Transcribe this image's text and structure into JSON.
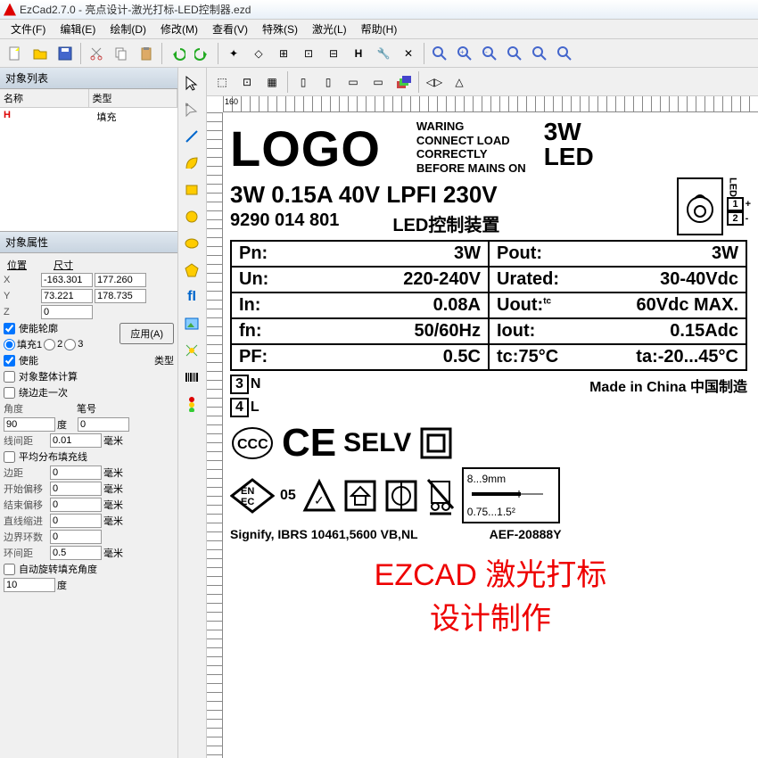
{
  "titlebar": {
    "text": "EzCad2.7.0 - 亮点设计-激光打标-LED控制器.ezd"
  },
  "menu": [
    "文件(F)",
    "编辑(E)",
    "绘制(D)",
    "修改(M)",
    "查看(V)",
    "特殊(S)",
    "激光(L)",
    "帮助(H)"
  ],
  "panels": {
    "objlist_title": "对象列表",
    "objprops_title": "对象属性",
    "col_name": "名称",
    "col_type": "类型",
    "row_type": "填充"
  },
  "props": {
    "pos_label": "位置",
    "size_label": "尺寸",
    "x": "-163.301",
    "w": "177.260",
    "y": "73.221",
    "h": "178.735",
    "z": "0",
    "apply": "应用(A)",
    "enable_outline": "使能轮廓",
    "fill1": "填充1",
    "fill2": "2",
    "fill3": "3",
    "enable": "使能",
    "type_label": "类型",
    "whole_calc": "对象整体计算",
    "edge_once": "绕边走一次",
    "angle_label": "角度",
    "pen_label": "笔号",
    "angle": "90",
    "angle_unit": "度",
    "pen": "0",
    "line_gap_label": "线间距",
    "line_gap": "0.01",
    "mm": "毫米",
    "avg_hatch": "平均分布填充线",
    "margin_label": "边距",
    "margin": "0",
    "start_off_label": "开始偏移",
    "start_off": "0",
    "end_off_label": "结束偏移",
    "end_off": "0",
    "line_red_label": "直线缩进",
    "line_red": "0",
    "loops_label": "边界环数",
    "loops": "0",
    "ring_gap_label": "环间距",
    "ring_gap": "0.5",
    "auto_rotate": "自动旋转填充角度",
    "auto_angle": "10"
  },
  "design": {
    "logo": "LOGO",
    "warn1": "WARING",
    "warn2": "CONNECT LOAD",
    "warn3": "CORRECTLY",
    "warn4": "BEFORE MAINS ON",
    "wattage": "3W",
    "led": "LED",
    "specline": "3W  0.15A 40V LPFI 230V",
    "partno": "9290 014 801",
    "devname": "LED控制装置",
    "term1": "1",
    "term1s": "+",
    "term2": "2",
    "term2s": "-",
    "specs": [
      {
        "l": "Pn:",
        "lv": "3W",
        "r": "Pout:",
        "rv": "3W"
      },
      {
        "l": "Un:",
        "lv": "220-240V",
        "r": "Urated:",
        "rv": "30-40Vdc"
      },
      {
        "l": "In:",
        "lv": "0.08A",
        "r": "Uout:",
        "rv": "60Vdc MAX."
      },
      {
        "l": "fn:",
        "lv": "50/60Hz",
        "r": "Iout:",
        "rv": "0.15Adc"
      },
      {
        "l": "PF:",
        "lv": "0.5C",
        "r": "tc:75°C",
        "rv": "ta:-20...45°C"
      }
    ],
    "term_n": "3",
    "term_n_lbl": "N",
    "term_l": "4",
    "term_l_lbl": "L",
    "made_in": "Made in China  中国制造",
    "selv": "SELV",
    "enec": "05",
    "dim1": "8...9mm",
    "dim2": "0.75...1.5²",
    "signify": "Signify, IBRS 10461,5600 VB,NL",
    "aef": "AEF-20888Y",
    "tc_sup": "tc"
  },
  "overlay": {
    "line1": "EZCAD 激光打标",
    "line2": "设计制作"
  },
  "ruler": {
    "t160": "160"
  }
}
